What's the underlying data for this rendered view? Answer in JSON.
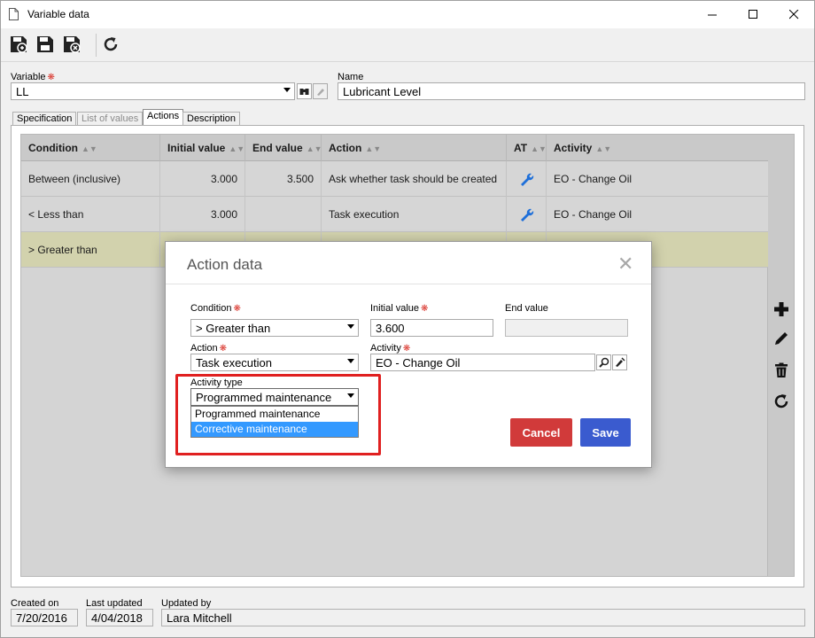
{
  "window": {
    "title": "Variable data",
    "icon": "document-icon"
  },
  "toolbar": {
    "buttons": [
      "save-new-icon",
      "save-icon",
      "save-close-icon",
      "refresh-icon"
    ]
  },
  "form": {
    "variable_label": "Variable",
    "variable_value": "LL",
    "name_label": "Name",
    "name_value": "Lubricant Level"
  },
  "tabs": [
    {
      "label": "Specification",
      "state": "normal"
    },
    {
      "label": "List of values",
      "state": "disabled"
    },
    {
      "label": "Actions",
      "state": "active"
    },
    {
      "label": "Description",
      "state": "normal"
    }
  ],
  "grid": {
    "columns": [
      "Condition",
      "Initial value",
      "End value",
      "Action",
      "AT",
      "Activity"
    ],
    "rows": [
      {
        "condition": "Between (inclusive)",
        "initial": "3.000",
        "end": "3.500",
        "action": "Ask whether task should be created",
        "at_icon": "wrench-icon",
        "activity": "EO - Change Oil"
      },
      {
        "condition": "< Less than",
        "initial": "3.000",
        "end": "",
        "action": "Task execution",
        "at_icon": "wrench-icon",
        "activity": "EO - Change Oil"
      },
      {
        "condition": "> Greater than",
        "initial": "",
        "end": "",
        "action": "",
        "at_icon": "",
        "activity": ""
      }
    ]
  },
  "side_tools": [
    "add-icon",
    "edit-icon",
    "delete-icon",
    "refresh-icon"
  ],
  "modal": {
    "title": "Action data",
    "condition_label": "Condition",
    "condition_value": "> Greater than",
    "initial_label": "Initial value",
    "initial_value": "3.600",
    "end_label": "End value",
    "end_value": "",
    "action_label": "Action",
    "action_value": "Task execution",
    "activity_label": "Activity",
    "activity_value": "EO - Change Oil",
    "activity_type_label": "Activity type",
    "activity_type_value": "Programmed maintenance",
    "activity_type_options": [
      "Programmed maintenance",
      "Corrective maintenance"
    ],
    "activity_type_highlighted": "Corrective maintenance",
    "cancel_label": "Cancel",
    "save_label": "Save"
  },
  "footer": {
    "created_label": "Created on",
    "created_value": "7/20/2016",
    "updated_label": "Last updated",
    "updated_value": "4/04/2018",
    "updated_by_label": "Updated by",
    "updated_by_value": "Lara Mitchell"
  },
  "colors": {
    "required": "#d9342b",
    "cancel": "#d13a3a",
    "save": "#3a5bcf",
    "selected_option": "#3399ff",
    "callout": "#e02020",
    "wrench": "#1e6fd9"
  }
}
